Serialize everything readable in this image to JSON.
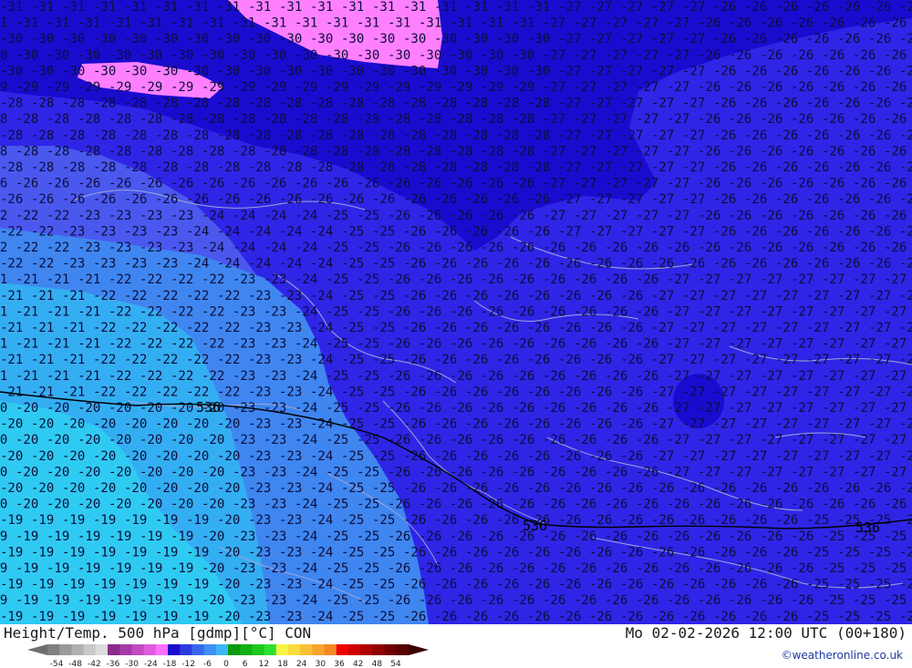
{
  "map": {
    "contour_labels": [
      "19",
      "20",
      "21",
      "22",
      "23",
      "24",
      "25",
      "26",
      "27",
      "28",
      "29",
      "30",
      "31"
    ],
    "height_label": "536",
    "temperature_range_c": [
      -31,
      -19
    ],
    "colors": {
      "band_minus_31": "#ff80ff",
      "band_minus_29": "#1a0ccf",
      "band_minus_27": "#2f25e6",
      "band_minus_25": "#4a58ee",
      "band_minus_23": "#3f86f0",
      "band_minus_21": "#34aef2",
      "band_minus_19": "#2fcaf2",
      "isotherm_text": "#0d0d3a",
      "border_lines": "#9ea6d8"
    }
  },
  "footer": {
    "title": "Height/Temp. 500 hPa [gdmp][°C] CON",
    "valid": "Mo 02-02-2026 12:00 UTC (00+180)",
    "credit": "©weatheronline.co.uk"
  },
  "legend": {
    "ticks": [
      "-54",
      "-48",
      "-42",
      "-36",
      "-30",
      "-24",
      "-18",
      "-12",
      "-6",
      "0",
      "6",
      "12",
      "18",
      "24",
      "30",
      "36",
      "42",
      "48",
      "54"
    ],
    "colors": [
      "#808080",
      "#999999",
      "#b0b0b0",
      "#c8c8c8",
      "#dcdcdc",
      "#8b2a8c",
      "#a63aa6",
      "#c24bc2",
      "#de5cde",
      "#ff6fff",
      "#1e0bd0",
      "#2a3ce0",
      "#3a66ee",
      "#3f8ff4",
      "#3ab7f4",
      "#0a9a0a",
      "#12b012",
      "#1cc81c",
      "#2ee02e",
      "#f4f444",
      "#f8dc3c",
      "#f8c034",
      "#f8a42c",
      "#f48824",
      "#f00000",
      "#d00000",
      "#b00000",
      "#900000",
      "#700000",
      "#580000"
    ]
  }
}
